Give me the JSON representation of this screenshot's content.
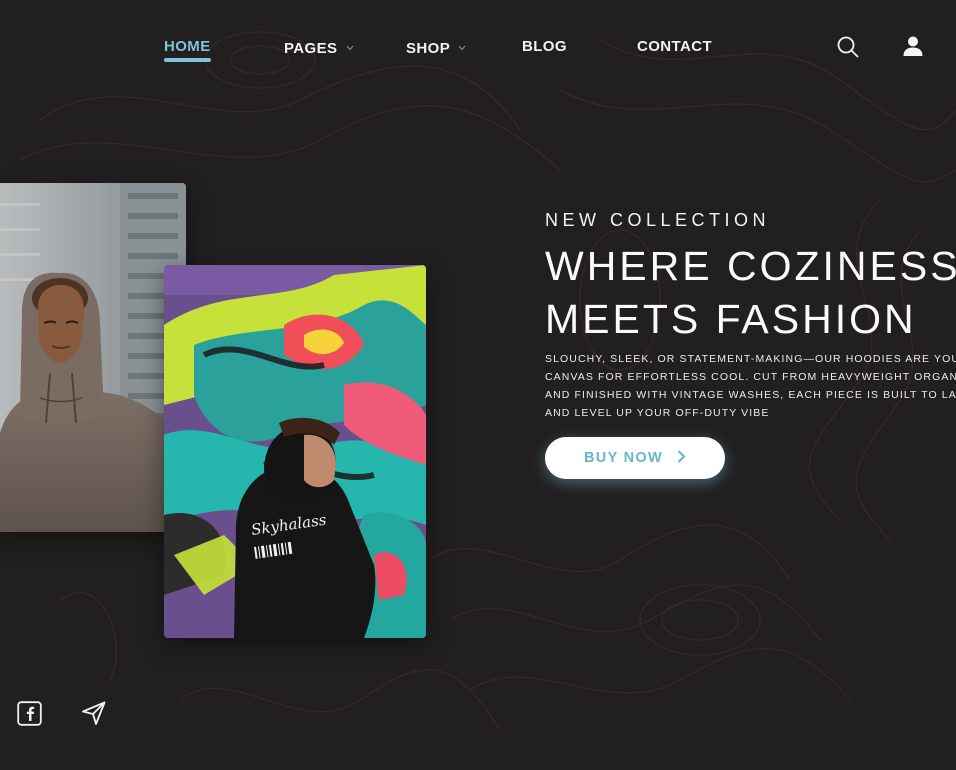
{
  "nav": {
    "items": [
      {
        "label": "HOME",
        "active": true
      },
      {
        "label": "PAGES",
        "dropdown": true
      },
      {
        "label": "SHOP",
        "dropdown": true
      },
      {
        "label": "BLOG"
      },
      {
        "label": "CONTACT"
      }
    ],
    "icons": [
      "search-icon",
      "user-icon"
    ]
  },
  "hero": {
    "eyebrow": "NEW COLLECTION",
    "headline_line1": "WHERE COZINESS",
    "headline_line2": "MEETS FASHION",
    "description_lines": [
      "SLOUCHY, SLEEK, OR STATEMENT-MAKING—OUR HOODIES ARE YOUR",
      "CANVAS FOR EFFORTLESS COOL. CUT FROM HEAVYWEIGHT ORGANIC",
      "AND FINISHED WITH VINTAGE WASHES, EACH PIECE IS BUILT TO LAST",
      "AND LEVEL UP YOUR OFF-DUTY VIBE"
    ],
    "cta_label": "BUY NOW"
  },
  "images": {
    "photo1": "man-in-brown-hoodie",
    "photo2": "woman-in-black-hoodie-graffiti",
    "hoodie_print": "Skyhalass"
  },
  "social": {
    "icons": [
      "facebook-icon",
      "send-icon"
    ]
  },
  "colors": {
    "background": "#221f20",
    "accent": "#7fc3d8",
    "text": "#ffffff",
    "topo_lines": "#3a2a26"
  }
}
